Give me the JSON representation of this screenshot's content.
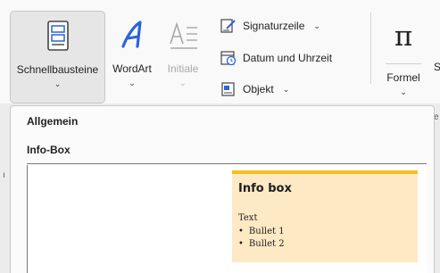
{
  "ribbon": {
    "schnellbausteine": {
      "label": "Schnellbausteine",
      "icon": "quick-parts-icon"
    },
    "wordart": {
      "label": "WordArt",
      "icon": "wordart-icon"
    },
    "initiale": {
      "label": "Initiale",
      "icon": "drop-cap-icon",
      "state": "disabled"
    },
    "signaturzeile": {
      "label": "Signaturzeile",
      "icon": "signature-line-icon"
    },
    "datum": {
      "label": "Datum und Uhrzeit",
      "icon": "date-time-icon"
    },
    "objekt": {
      "label": "Objekt",
      "icon": "object-icon"
    },
    "formel": {
      "label": "Formel",
      "symbol": "π",
      "icon": "equation-icon"
    },
    "cut_label": "S",
    "chevron": "⌄"
  },
  "dropdown": {
    "heading": "Allgemein",
    "subheading": "Info-Box",
    "preview": {
      "title": "Info box",
      "body": "Text",
      "bullets": [
        "Bullet 1",
        "Bullet 2"
      ]
    }
  },
  "doc_markers": {
    "top": "e",
    "left": "ı"
  },
  "colors": {
    "accent_blue": "#2b63d9",
    "info_fill": "#fde9c4",
    "info_border": "#f4bf24",
    "selected_button_bg": "#e6e6e6"
  }
}
